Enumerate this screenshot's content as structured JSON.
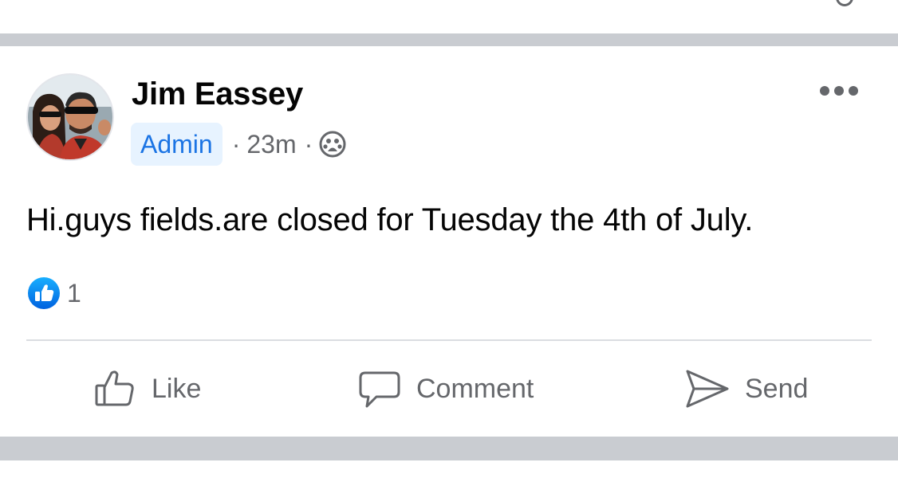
{
  "post": {
    "author": "Jim Eassey",
    "role_badge": "Admin",
    "separator": "·",
    "time": "23m",
    "privacy_icon": "group-icon",
    "text": "Hi.guys fields.are closed for Tuesday the 4th of July.",
    "reactions": {
      "icon": "like-reaction-icon",
      "count": "1"
    },
    "actions": {
      "like_label": "Like",
      "comment_label": "Comment",
      "send_label": "Send"
    }
  },
  "colors": {
    "accent": "#1b74e4",
    "badge_background": "#e7f3ff",
    "secondary_text": "#65676b",
    "divider": "#c9ccd1"
  }
}
